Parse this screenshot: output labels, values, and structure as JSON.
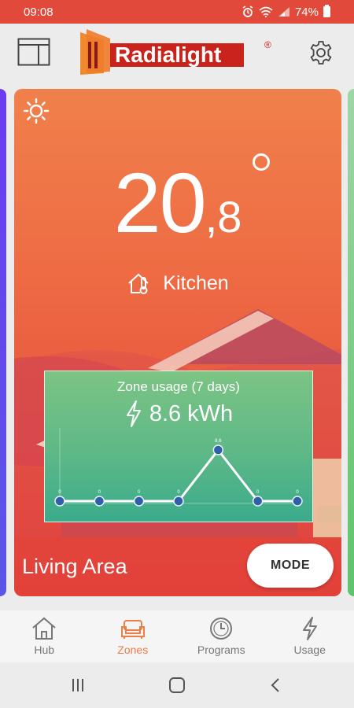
{
  "status_bar": {
    "time": "09:08",
    "battery": "74%"
  },
  "header": {
    "logo_text": "Radialight",
    "logo_mark": "®"
  },
  "zone": {
    "temperature_int": "20",
    "temperature_dec": ",8",
    "name": "Kitchen",
    "area": "Living Area",
    "mode_label": "MODE"
  },
  "usage": {
    "title": "Zone usage (7 days)",
    "value": "8.6 kWh",
    "chart_data": {
      "type": "line",
      "x": [
        1,
        2,
        3,
        4,
        5,
        6,
        7
      ],
      "values": [
        0,
        0,
        0,
        0,
        8.6,
        0,
        0
      ],
      "point_labels": [
        "0",
        "0",
        "0",
        "0",
        "8.6",
        "0",
        "0"
      ],
      "ylim": [
        0,
        10
      ]
    }
  },
  "bottom_nav": [
    {
      "label": "Hub",
      "icon": "home-icon",
      "active": false
    },
    {
      "label": "Zones",
      "icon": "sofa-icon",
      "active": true
    },
    {
      "label": "Programs",
      "icon": "clock-icon",
      "active": false
    },
    {
      "label": "Usage",
      "icon": "lightning-icon",
      "active": false
    }
  ],
  "colors": {
    "accent": "#ee7d46",
    "status_bar": "#e14a3a",
    "usage_panel": "#5db887"
  }
}
